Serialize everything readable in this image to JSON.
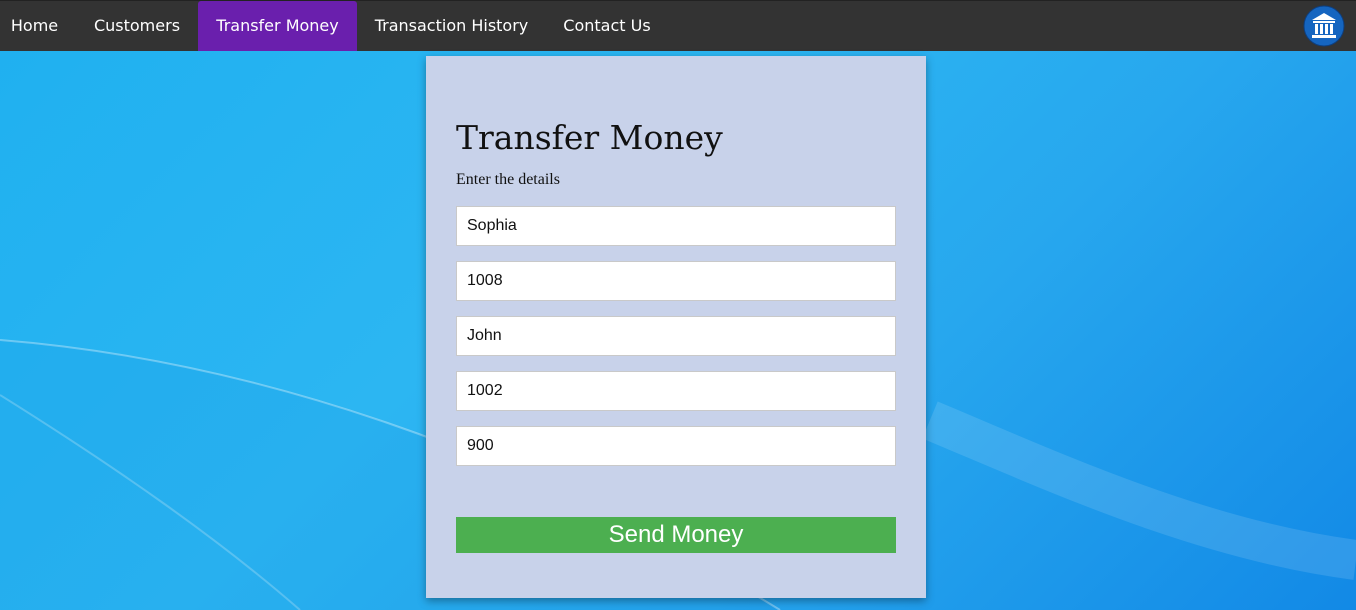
{
  "nav": {
    "items": [
      {
        "label": "Home"
      },
      {
        "label": "Customers"
      },
      {
        "label": "Transfer Money"
      },
      {
        "label": "Transaction History"
      },
      {
        "label": "Contact Us"
      }
    ],
    "active": "Transfer Money",
    "logo_icon": "bank-icon"
  },
  "form": {
    "title": "Transfer Money",
    "subtitle": "Enter the details",
    "fields": [
      {
        "value": "Sophia"
      },
      {
        "value": "1008"
      },
      {
        "value": "John"
      },
      {
        "value": "1002"
      },
      {
        "value": "900"
      }
    ],
    "submit_label": "Send Money"
  },
  "colors": {
    "navbar": "#333333",
    "active_tab": "#6a1fad",
    "card": "#c8d2ea",
    "button": "#4caf50",
    "logo": "#1565c0"
  }
}
